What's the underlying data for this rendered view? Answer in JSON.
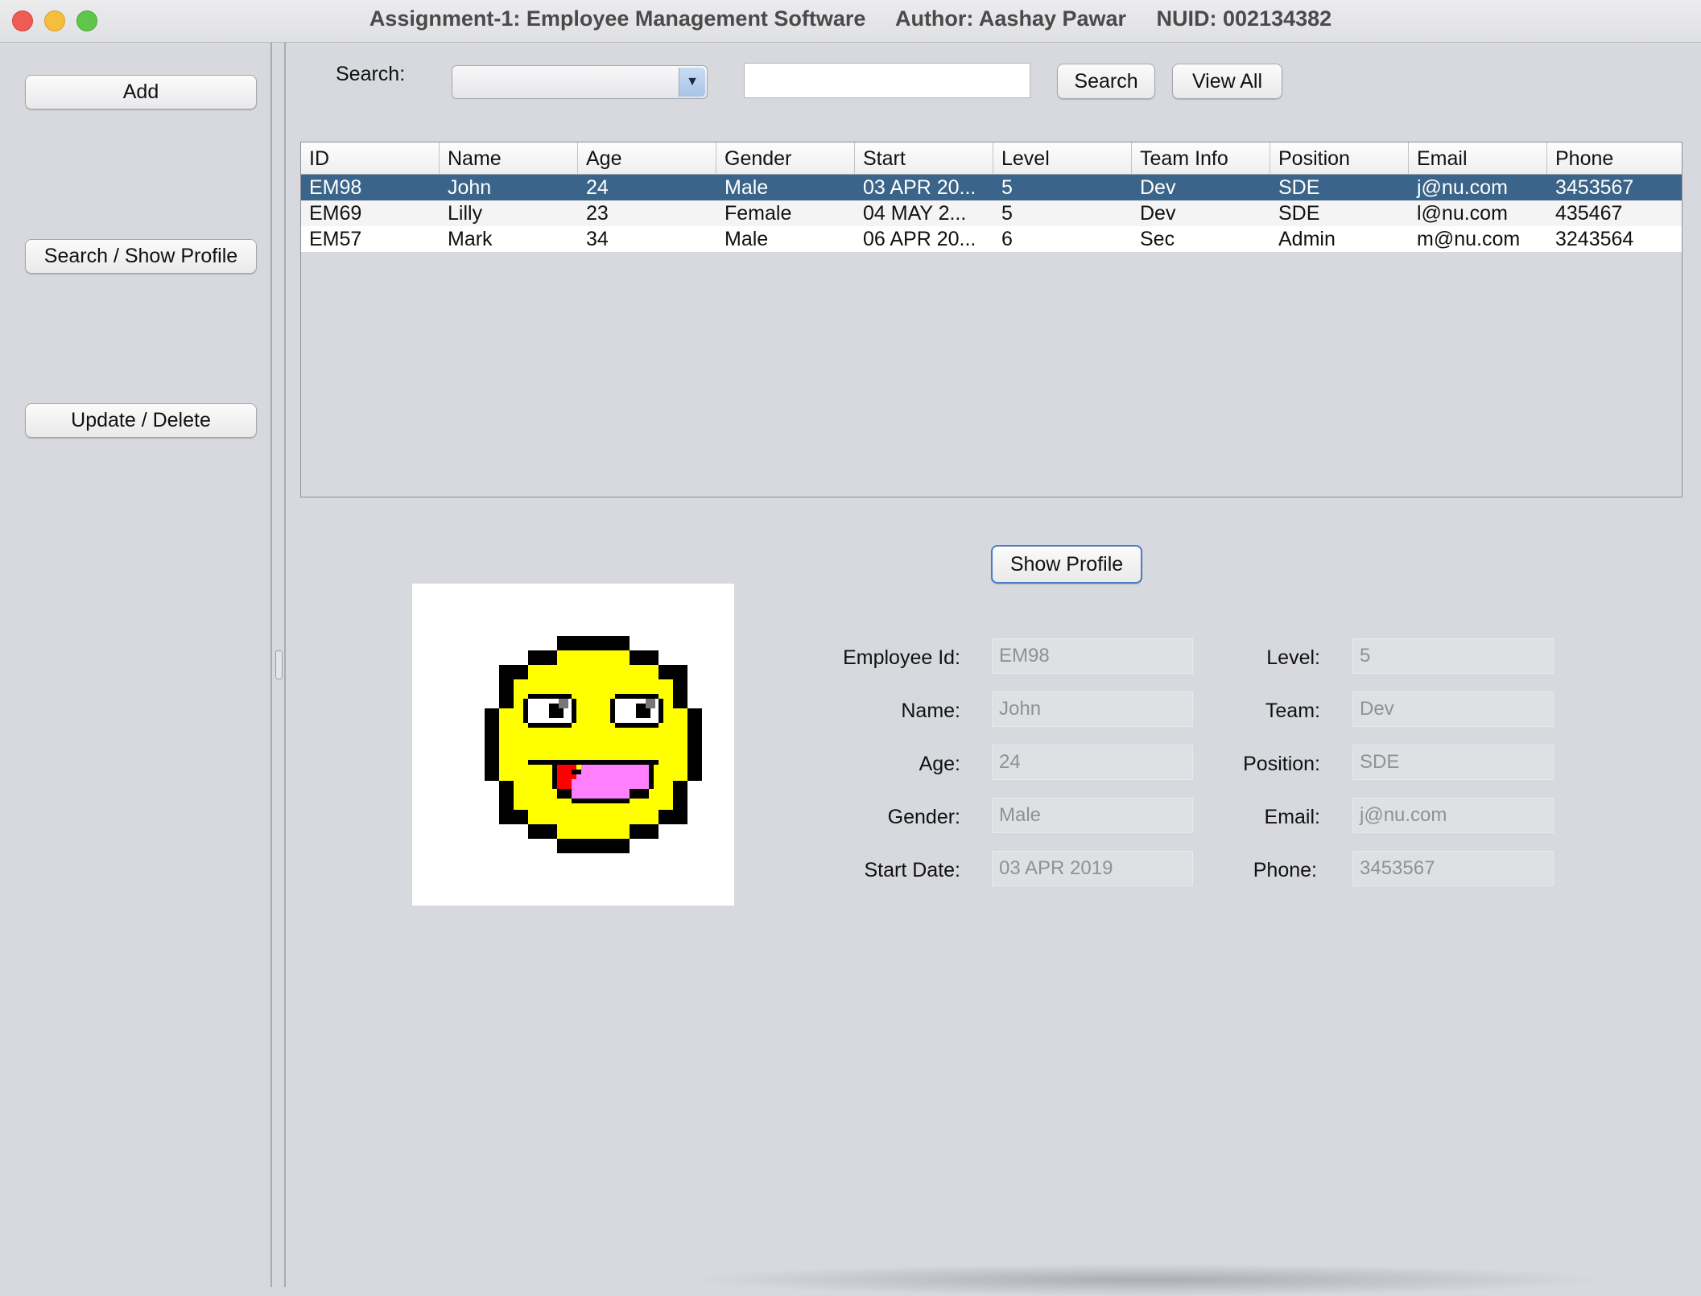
{
  "window": {
    "title": "Assignment-1: Employee Management Software     Author: Aashay Pawar     NUID: 002134382"
  },
  "sidebar": {
    "add_label": "Add",
    "search_profile_label": "Search / Show Profile",
    "update_delete_label": "Update / Delete"
  },
  "search": {
    "label": "Search:",
    "combo_value": "",
    "input_value": "",
    "search_button": "Search",
    "view_all_button": "View All"
  },
  "table": {
    "columns": [
      "ID",
      "Name",
      "Age",
      "Gender",
      "Start",
      "Level",
      "Team Info",
      "Position",
      "Email",
      "Phone"
    ],
    "rows": [
      [
        "EM98",
        "John",
        "24",
        "Male",
        "03 APR 20...",
        "5",
        "Dev",
        "SDE",
        "j@nu.com",
        "3453567"
      ],
      [
        "EM69",
        "Lilly",
        "23",
        "Female",
        "04 MAY 2...",
        "5",
        "Dev",
        "SDE",
        "l@nu.com",
        "435467"
      ],
      [
        "EM57",
        "Mark",
        "34",
        "Male",
        "06 APR 20...",
        "6",
        "Sec",
        "Admin",
        "m@nu.com",
        "3243564"
      ]
    ],
    "selected_row": 0
  },
  "profile": {
    "show_profile_button": "Show Profile",
    "labels": {
      "employee_id": "Employee Id:",
      "name": "Name:",
      "age": "Age:",
      "gender": "Gender:",
      "start_date": "Start Date:",
      "level": "Level:",
      "team": "Team:",
      "position": "Position:",
      "email": "Email:",
      "phone": "Phone:"
    },
    "values": {
      "employee_id": "EM98",
      "name": "John",
      "age": "24",
      "gender": "Male",
      "start_date": "03 APR 2019",
      "level": "5",
      "team": "Dev",
      "position": "SDE",
      "email": "j@nu.com",
      "phone": "3453567"
    },
    "avatar_icon": "pixel-smiley-tongue-icon"
  },
  "colors": {
    "selection": "#3a6489",
    "window_bg": "#d7d9de",
    "smiley_yellow": "#ffff00",
    "tongue_pink": "#ff80ff",
    "tongue_red": "#ff0000"
  }
}
